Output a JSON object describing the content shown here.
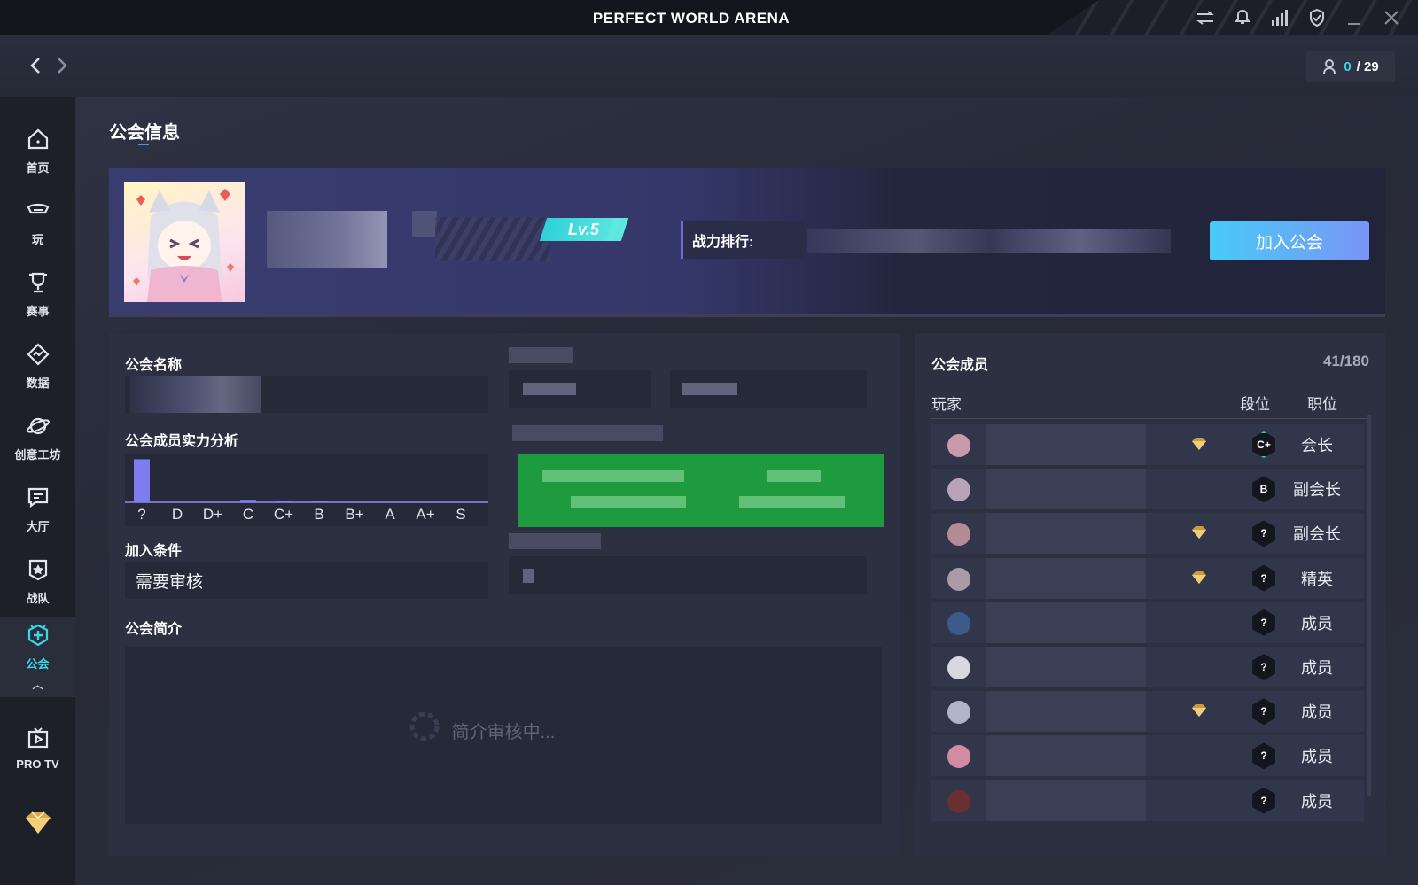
{
  "titlebar": {
    "title": "PERFECT WORLD ARENA",
    "icons": [
      "swap-icon",
      "bell-icon",
      "signal-icon",
      "shield-check-icon",
      "minimize-icon",
      "close-icon"
    ]
  },
  "navbar": {
    "counter_current": "0",
    "counter_total": "/ 29"
  },
  "sidebar": {
    "items": [
      {
        "label": "首页",
        "icon": "home-icon"
      },
      {
        "label": "玩",
        "icon": "play-icon"
      },
      {
        "label": "赛事",
        "icon": "trophy-icon"
      },
      {
        "label": "数据",
        "icon": "data-icon"
      },
      {
        "label": "创意工坊",
        "icon": "workshop-icon"
      },
      {
        "label": "大厅",
        "icon": "lobby-icon"
      },
      {
        "label": "战队",
        "icon": "team-icon"
      },
      {
        "label": "公会",
        "icon": "guild-icon"
      },
      {
        "label": "PRO TV",
        "icon": "tv-icon"
      }
    ],
    "active": "公会",
    "accent": "#3ad6e6"
  },
  "page": {
    "title": "公会信息"
  },
  "banner": {
    "level": "Lv.5",
    "rank_label": "战力排行:",
    "join_button": "加入公会"
  },
  "info": {
    "guild_name_label": "公会名称",
    "strength_label": "公会成员实力分析",
    "join_condition_label": "加入条件",
    "join_condition_value": "需要审核",
    "intro_label": "公会简介",
    "intro_status": "简介审核中..."
  },
  "chart_data": {
    "type": "bar",
    "categories": [
      "?",
      "D",
      "D+",
      "C",
      "C+",
      "B",
      "B+",
      "A",
      "A+",
      "S"
    ],
    "values": [
      34,
      0,
      0,
      2,
      1,
      1,
      0,
      0,
      0,
      0
    ],
    "ylim": [
      0,
      35
    ],
    "grid": false,
    "color": "#7f7cf0"
  },
  "members": {
    "title": "公会成员",
    "count": "41/180",
    "columns": {
      "player": "玩家",
      "rank": "段位",
      "role": "职位"
    },
    "rows": [
      {
        "rank": "C+",
        "role": "会长",
        "gem": true,
        "avatar_color": "#c89aac"
      },
      {
        "rank": "B",
        "role": "副会长",
        "gem": false,
        "avatar_color": "#b8a3b8"
      },
      {
        "rank": "?",
        "role": "副会长",
        "gem": true,
        "avatar_color": "#b48b96"
      },
      {
        "rank": "?",
        "role": "精英",
        "gem": true,
        "avatar_color": "#a99aa5"
      },
      {
        "rank": "?",
        "role": "成员",
        "gem": false,
        "avatar_color": "#3b5b8a"
      },
      {
        "rank": "?",
        "role": "成员",
        "gem": false,
        "avatar_color": "#d8d8e0"
      },
      {
        "rank": "?",
        "role": "成员",
        "gem": true,
        "avatar_color": "#b0b4c8"
      },
      {
        "rank": "?",
        "role": "成员",
        "gem": false,
        "avatar_color": "#d28ba0"
      },
      {
        "rank": "?",
        "role": "成员",
        "gem": false,
        "avatar_color": "#6a2f30"
      }
    ]
  }
}
